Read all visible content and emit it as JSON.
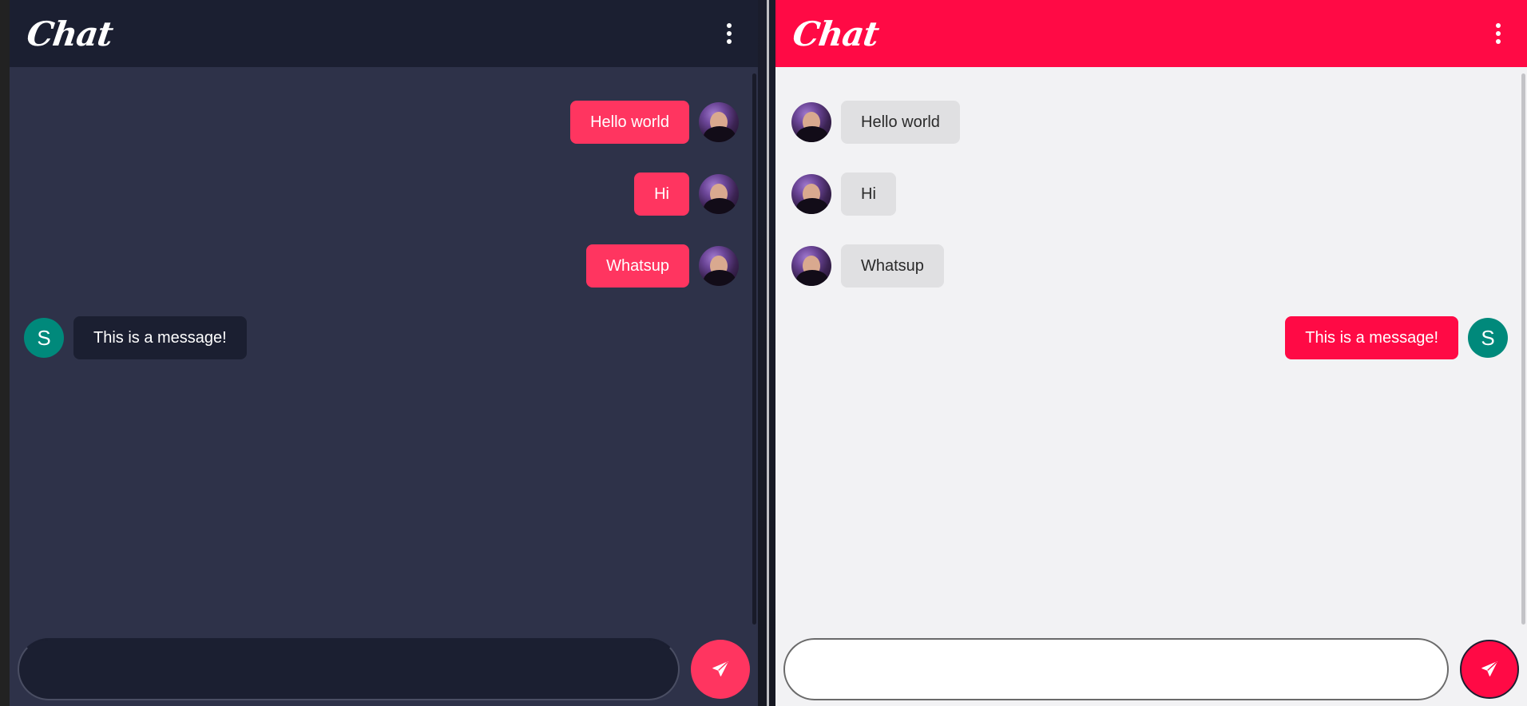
{
  "app": {
    "logo_text": "Chat"
  },
  "dark_pane": {
    "messages": [
      {
        "text": "Hello world",
        "side": "right",
        "avatar": "photo"
      },
      {
        "text": "Hi",
        "side": "right",
        "avatar": "photo"
      },
      {
        "text": "Whatsup",
        "side": "right",
        "avatar": "photo"
      },
      {
        "text": "This is a message!",
        "side": "left",
        "avatar": "letter",
        "avatar_letter": "S"
      }
    ],
    "input_placeholder": "",
    "colors": {
      "header": "#1b1f31",
      "background": "#2e3249",
      "outgoing_bubble": "#ff3560",
      "incoming_bubble": "#1b1f31"
    }
  },
  "light_pane": {
    "messages": [
      {
        "text": "Hello world",
        "side": "left",
        "avatar": "photo"
      },
      {
        "text": "Hi",
        "side": "left",
        "avatar": "photo"
      },
      {
        "text": "Whatsup",
        "side": "left",
        "avatar": "photo"
      },
      {
        "text": "This is a message!",
        "side": "right",
        "avatar": "letter",
        "avatar_letter": "S"
      }
    ],
    "input_placeholder": "",
    "colors": {
      "header": "#ff0a45",
      "background": "#f2f2f4",
      "outgoing_bubble": "#ff0a45",
      "incoming_bubble": "#e0e0e2"
    }
  },
  "icons": {
    "menu": "more-vert-icon",
    "send": "paper-plane-icon"
  }
}
